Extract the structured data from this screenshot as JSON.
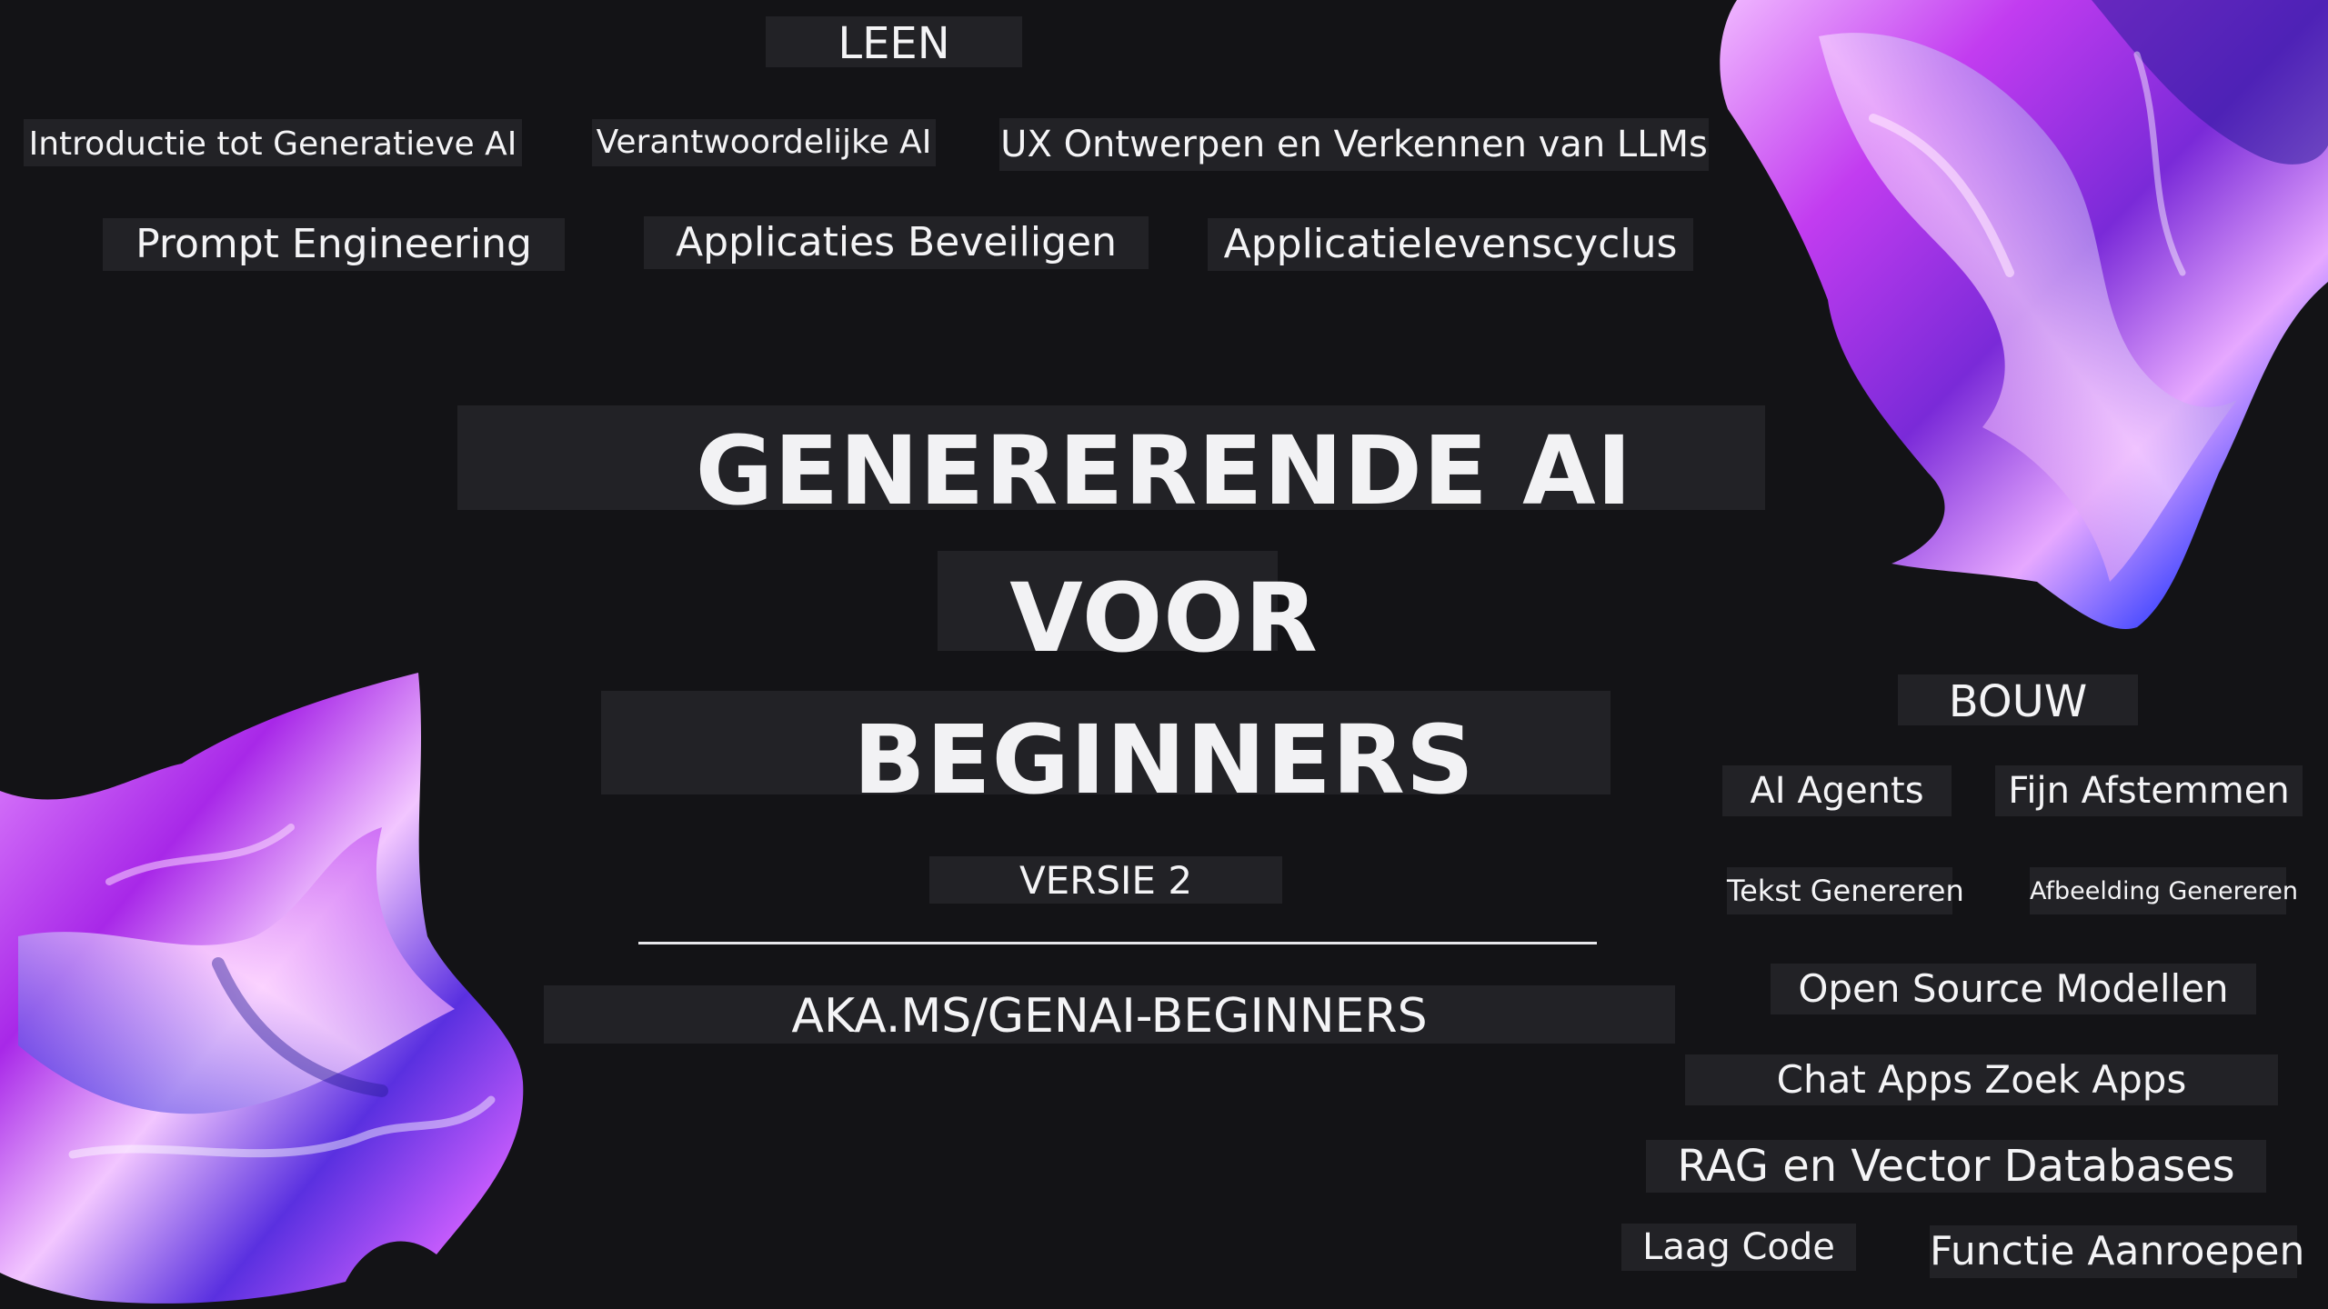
{
  "learn": {
    "heading": "LEEN",
    "topics": [
      "Introductie tot Generatieve AI",
      "Verantwoordelijke AI",
      "UX Ontwerpen en Verkennen van LLMs",
      "Prompt Engineering",
      "Applicaties Beveiligen",
      "Applicatielevenscyclus"
    ]
  },
  "title": {
    "line1": "GENERERENDE AI",
    "line2": "VOOR",
    "line3": "BEGINNERS",
    "version": "VERSIE 2",
    "url": "AKA.MS/GENAI-BEGINNERS"
  },
  "build": {
    "heading": "BOUW",
    "topics": [
      "AI Agents",
      "Fijn Afstemmen",
      "Tekst Genereren",
      "Afbeelding Genereren",
      "Open Source Modellen",
      "Chat Apps Zoek Apps",
      "RAG en Vector Databases",
      "Laag Code",
      "Functie Aanroepen"
    ]
  },
  "colors": {
    "background": "#131316",
    "chip": "#222226",
    "accent_purple": "#c44dff",
    "accent_blue": "#4a4cff"
  }
}
